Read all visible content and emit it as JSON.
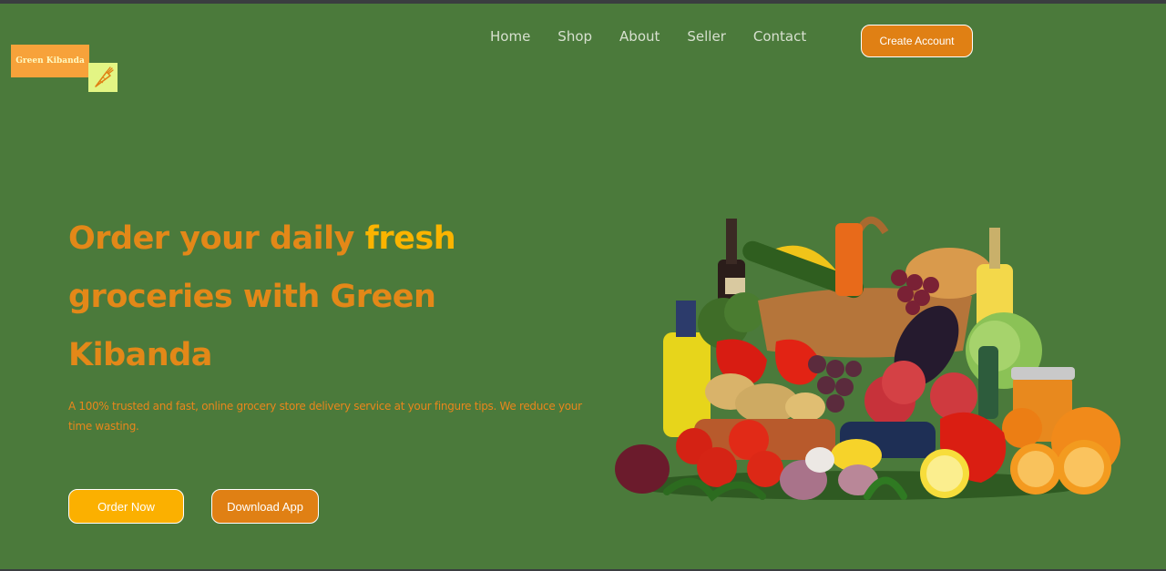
{
  "brand": {
    "name": "Green Kibanda",
    "icon": "carrot-icon"
  },
  "nav": {
    "items": [
      "Home",
      "Shop",
      "About",
      "Seller",
      "Contact"
    ],
    "cta": "Create Account"
  },
  "hero": {
    "headline_part1": "Order your daily",
    "headline_highlight": "fresh",
    "headline_part2": "groceries with Green Kibanda",
    "subtext": "A 100% trusted and fast, online grocery store delivery service at your fingure tips. We reduce your time wasting.",
    "order_button": "Order Now",
    "download_button": "Download App",
    "image": "grocery-basket-illustration"
  },
  "colors": {
    "background": "#4b7a3b",
    "accent_orange": "#e08014",
    "accent_yellow": "#fbb000",
    "logo_orange": "#f7a23a"
  }
}
